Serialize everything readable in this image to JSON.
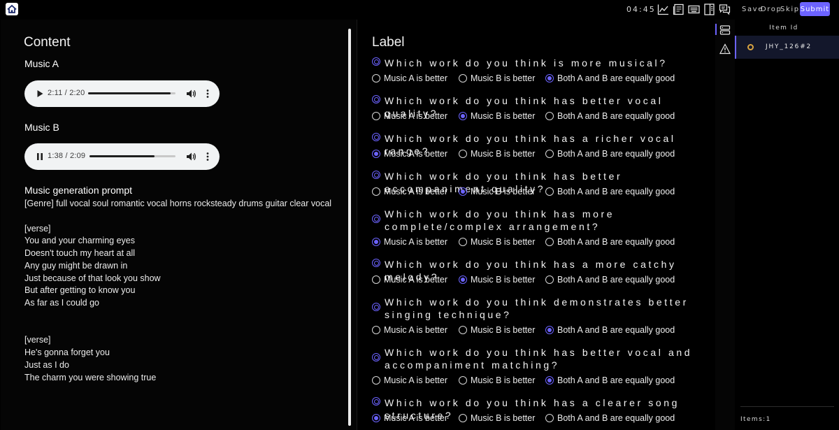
{
  "topbar": {
    "timer": "04:45",
    "icons": [
      "home-icon",
      "line-chart-icon",
      "document-icon",
      "keyboard-icon",
      "split-view-icon",
      "comments-icon"
    ],
    "save_label": "Save",
    "drop_label": "Drop",
    "skip_label": "Skip",
    "submit_label": "Submit",
    "accent_color": "#6c63ff"
  },
  "content": {
    "title": "Content",
    "music_a": {
      "label": "Music A",
      "state": "paused",
      "current_time": "2:11",
      "separator": "/",
      "duration": "2:20",
      "progress": 0.94
    },
    "music_b": {
      "label": "Music B",
      "state": "playing",
      "current_time": "1:38",
      "separator": "/",
      "duration": "2:09",
      "progress": 0.76
    },
    "prompt_title": "Music generation prompt",
    "prompt_lines": [
      "[Genre] full vocal soul romantic vocal horns rocksteady drums guitar clear vocal",
      "[verse]",
      "You and your charming eyes",
      "Doesn't touch my heart at all",
      "Any guy might be drawn in",
      "Just because of that look you show",
      "But after getting to know you",
      "As far as I could go",
      "[verse]",
      "He's gonna forget you",
      "Just as I do",
      "The charm you were showing true"
    ]
  },
  "label": {
    "title": "Label",
    "options": [
      "Music A is better",
      "Music B is better",
      "Both A and B are equally good"
    ],
    "questions": [
      {
        "text": "Which work do you think is more musical?",
        "selected": 2
      },
      {
        "text": "Which work do you think has better vocal quality?",
        "selected": 1
      },
      {
        "text": "Which work do you think has a richer vocal range?",
        "selected": 0
      },
      {
        "text": "Which work do you think has better accompaniment quality?",
        "selected": 1
      },
      {
        "text": "Which work do you think has more complete/complex arrangement?",
        "selected": 0
      },
      {
        "text": "Which work do you think has a more catchy melody?",
        "selected": 1
      },
      {
        "text": "Which work do you think demonstrates better singing technique?",
        "selected": 2
      },
      {
        "text": "Which work do you think has better vocal and accompaniment matching?",
        "selected": 2
      },
      {
        "text": "Which work do you think has a clearer song structure?",
        "selected": 0
      }
    ]
  },
  "sidebar": {
    "icons": [
      "list-icon",
      "warning-icon"
    ]
  },
  "items": {
    "header": "Item Id",
    "list": [
      {
        "id": "JHY_126#2",
        "status_color": "#d9a441"
      }
    ],
    "count_label": "Items:1"
  }
}
